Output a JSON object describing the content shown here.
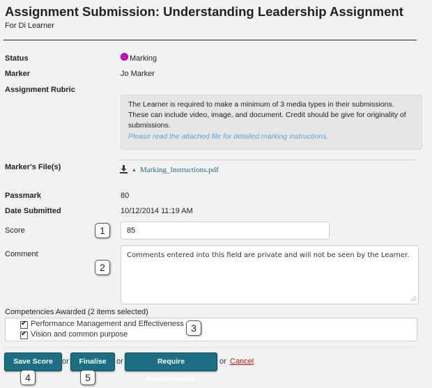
{
  "header": {
    "title": "Assignment Submission: Understanding Leadership Assignment",
    "subtitle": "For Di Learner"
  },
  "details": {
    "status_label": "Status",
    "status_value": "Marking",
    "status_color": "#d400d4",
    "marker_label": "Marker",
    "marker_value": "Jo Marker",
    "rubric_label": "Assignment Rubric",
    "rubric_text": "The Learner is required to make a minimum of 3 media types in their submissions.  These can include video, image, and document.  Credit should be give for originality of submissions.",
    "rubric_note": "Please read the attached file for detailed marking instructions.",
    "files_label": "Marker's File(s)",
    "file_name": "Marking_Instructions.pdf",
    "passmark_label": "Passmark",
    "passmark_value": "80",
    "date_label": "Date Submitted",
    "date_value": "10/12/2014 11:19 AM"
  },
  "form": {
    "score_label": "Score",
    "score_value": "85",
    "comment_label": "Comment",
    "comment_value": "Comments entered into this field are private and will not be seen by the Learner."
  },
  "competencies": {
    "label": "Competencies Awarded (2 items selected)",
    "items": [
      {
        "label": "Performance Management and Effectiveness",
        "checked": true
      },
      {
        "label": "Vision and common purpose",
        "checked": true
      }
    ]
  },
  "actions": {
    "save_label": "Save Score",
    "or1": "or",
    "finalise_label": "Finalise",
    "or2": "or",
    "resubmit_label": "Require Resubmission",
    "or3": "or",
    "cancel_label": "Cancel"
  },
  "callouts": [
    "1",
    "2",
    "3",
    "4",
    "5"
  ],
  "colors": {
    "button": "#1c6e82",
    "cancel": "#cc1111",
    "link": "#2a6a85",
    "note": "#5ba3d6"
  }
}
